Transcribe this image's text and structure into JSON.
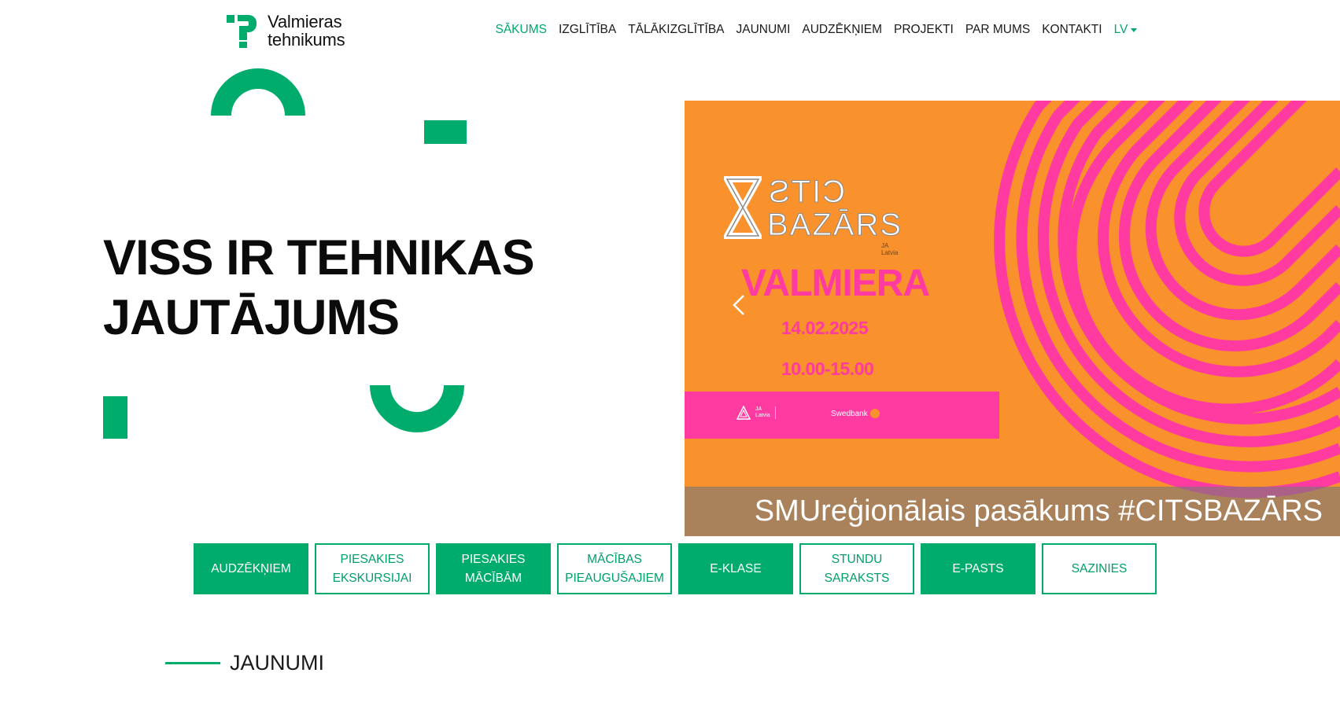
{
  "site": {
    "logo_line1": "Valmieras",
    "logo_line2": "tehnikums",
    "brand_color": "#00ac6b"
  },
  "nav": {
    "items": [
      {
        "label": "SĀKUMS",
        "active": true
      },
      {
        "label": "IZGLĪTĪBA",
        "active": false
      },
      {
        "label": "TĀLĀKIZGLĪTĪBA",
        "active": false
      },
      {
        "label": "JAUNUMI",
        "active": false
      },
      {
        "label": "AUDZĒKŅIEM",
        "active": false
      },
      {
        "label": "PROJEKTI",
        "active": false
      },
      {
        "label": "PAR MUMS",
        "active": false
      },
      {
        "label": "KONTAKTI",
        "active": false
      }
    ],
    "language": "LV"
  },
  "hero": {
    "title_line1": "VISS IR TEHNIKAS",
    "title_line2": "JAUTĀJUMS"
  },
  "slider": {
    "logo_top": "CITS",
    "logo_bottom": "BAZĀRS",
    "logo_badge_line1": "JA",
    "logo_badge_line2": "Latvia",
    "city": "VALMIERA",
    "date": "14.02.2025",
    "time": "10.00-15.00",
    "sponsor1_line1": "JA",
    "sponsor1_line2": "Latvia",
    "sponsor2": "Swedbank",
    "caption": "SMUreģionālais pasākums #CITSBAZĀRS",
    "bg_color": "#f9912c",
    "accent_color": "#ff3aa0"
  },
  "quick_links": [
    {
      "label": "AUDZĒKŅIEM",
      "style": "filled"
    },
    {
      "label": "PIESAKIES EKSKURSIJAI",
      "style": "outline"
    },
    {
      "label": "PIESAKIES MĀCĪBĀM",
      "style": "filled"
    },
    {
      "label": "MĀCĪBAS PIEAUGUŠAJIEM",
      "style": "outline"
    },
    {
      "label": "E-KLASE",
      "style": "filled"
    },
    {
      "label": "STUNDU SARAKSTS",
      "style": "outline"
    },
    {
      "label": "E-PASTS",
      "style": "filled"
    },
    {
      "label": "SAZINIES",
      "style": "outline"
    }
  ],
  "news": {
    "heading": "JAUNUMI"
  }
}
